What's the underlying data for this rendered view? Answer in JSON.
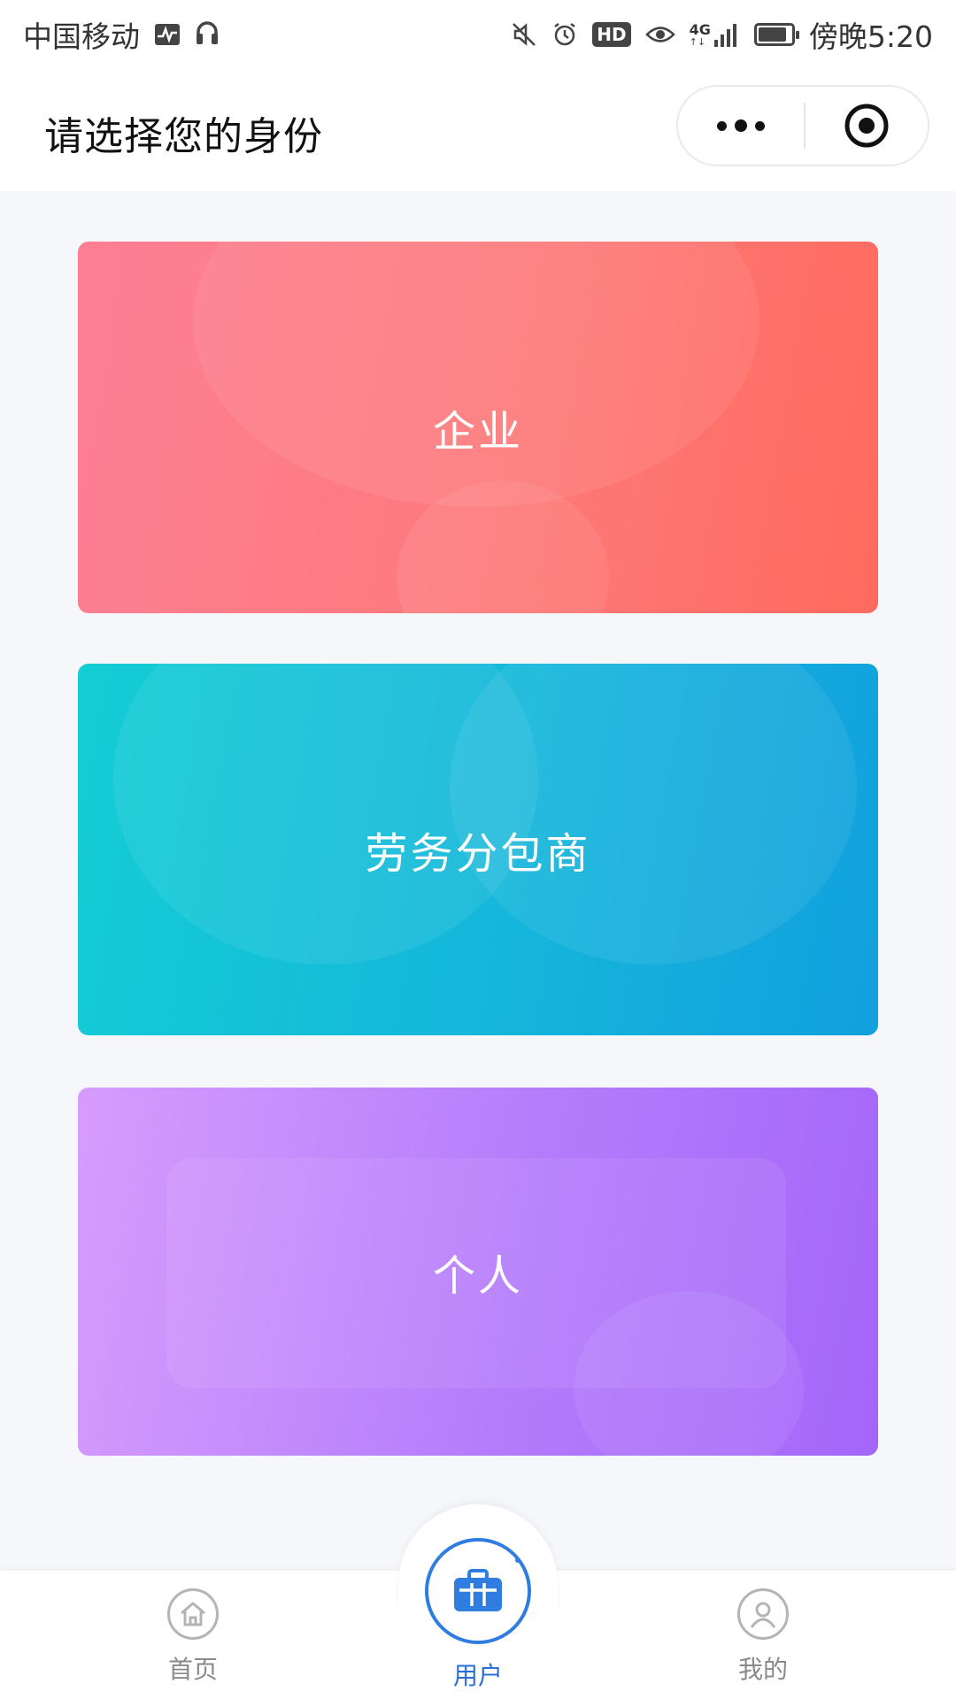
{
  "status_bar": {
    "carrier": "中国移动",
    "network": "4G",
    "hd": "HD",
    "time": "傍晚5:20",
    "battery_level": 0.85,
    "icons": [
      "activity-icon",
      "headset-icon",
      "mute-icon",
      "alarm-icon",
      "hd-icon",
      "eye-icon",
      "signal-icon",
      "battery-icon"
    ]
  },
  "header": {
    "title": "请选择您的身份",
    "capsule_icons": [
      "more-dots-icon",
      "close-target-icon"
    ]
  },
  "cards": [
    {
      "label": "企业",
      "color_start": "#fd7f95",
      "color_end": "#ff6a5e"
    },
    {
      "label": "劳务分包商",
      "color_start": "#14cdd4",
      "color_end": "#12a0de"
    },
    {
      "label": "个人",
      "color_start": "#d79cfd",
      "color_end": "#a466fa"
    }
  ],
  "tabbar": {
    "tabs": [
      {
        "label": "首页",
        "icon": "home-icon",
        "active": false
      },
      {
        "label": "用户",
        "icon": "briefcase-icon",
        "active": true
      },
      {
        "label": "我的",
        "icon": "person-icon",
        "active": false
      }
    ],
    "active_color": "#2a6fd8",
    "inactive_color": "#8a8a8a"
  }
}
